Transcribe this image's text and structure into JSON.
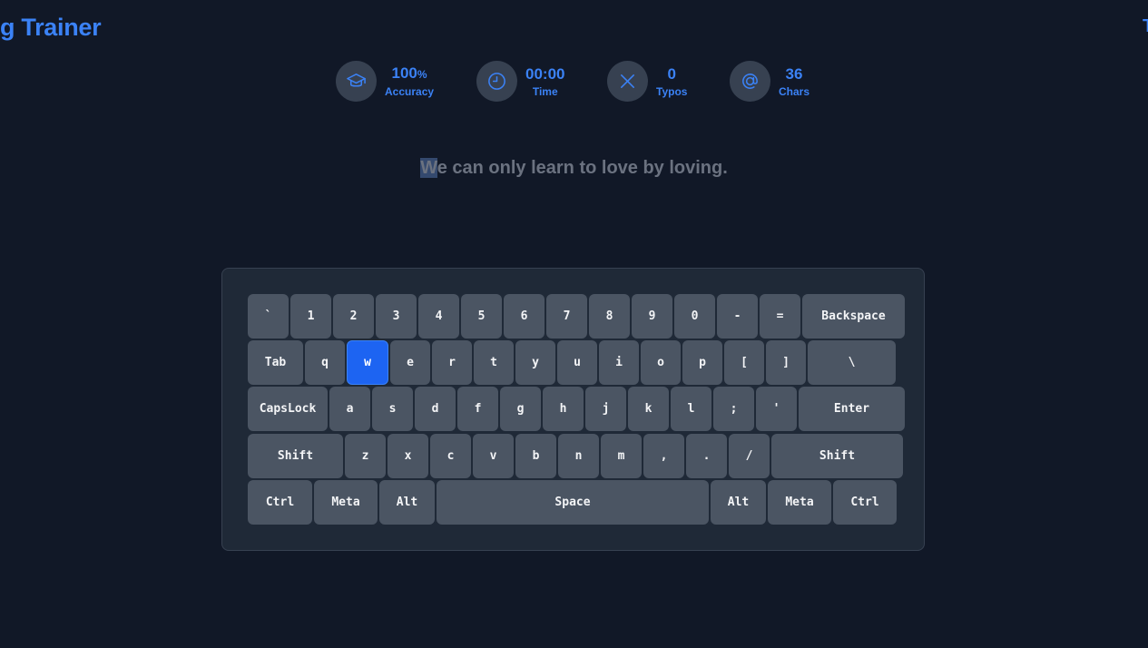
{
  "app": {
    "title": "g Trainer",
    "right_edge_glyph": "T"
  },
  "stats": {
    "accuracy": {
      "value": "100",
      "unit": "%",
      "label": "Accuracy",
      "icon": "graduation-cap-icon"
    },
    "time": {
      "value": "00:00",
      "label": "Time",
      "icon": "clock-icon"
    },
    "typos": {
      "value": "0",
      "label": "Typos",
      "icon": "x-icon"
    },
    "chars": {
      "value": "36",
      "label": "Chars",
      "icon": "at-sign-icon"
    }
  },
  "quote": {
    "current_char": "W",
    "rest": "e can only learn to love by loving."
  },
  "keyboard": {
    "active_key": "w",
    "colors": {
      "key": "#4b5563",
      "active_key": "#1d64f2",
      "panel": "#1f2937"
    },
    "rows": [
      [
        "`",
        "1",
        "2",
        "3",
        "4",
        "5",
        "6",
        "7",
        "8",
        "9",
        "0",
        "-",
        "=",
        "Backspace"
      ],
      [
        "Tab",
        "q",
        "w",
        "e",
        "r",
        "t",
        "y",
        "u",
        "i",
        "o",
        "p",
        "[",
        "]",
        "\\"
      ],
      [
        "CapsLock",
        "a",
        "s",
        "d",
        "f",
        "g",
        "h",
        "j",
        "k",
        "l",
        ";",
        "'",
        "Enter"
      ],
      [
        "Shift",
        "z",
        "x",
        "c",
        "v",
        "b",
        "n",
        "m",
        ",",
        ".",
        "/",
        "Shift"
      ],
      [
        "Ctrl",
        "Meta",
        "Alt",
        "Space",
        "Alt",
        "Meta",
        "Ctrl"
      ]
    ]
  },
  "theme": {
    "background": "#111827",
    "accent": "#3b82f6",
    "text_muted": "#6b7280"
  }
}
